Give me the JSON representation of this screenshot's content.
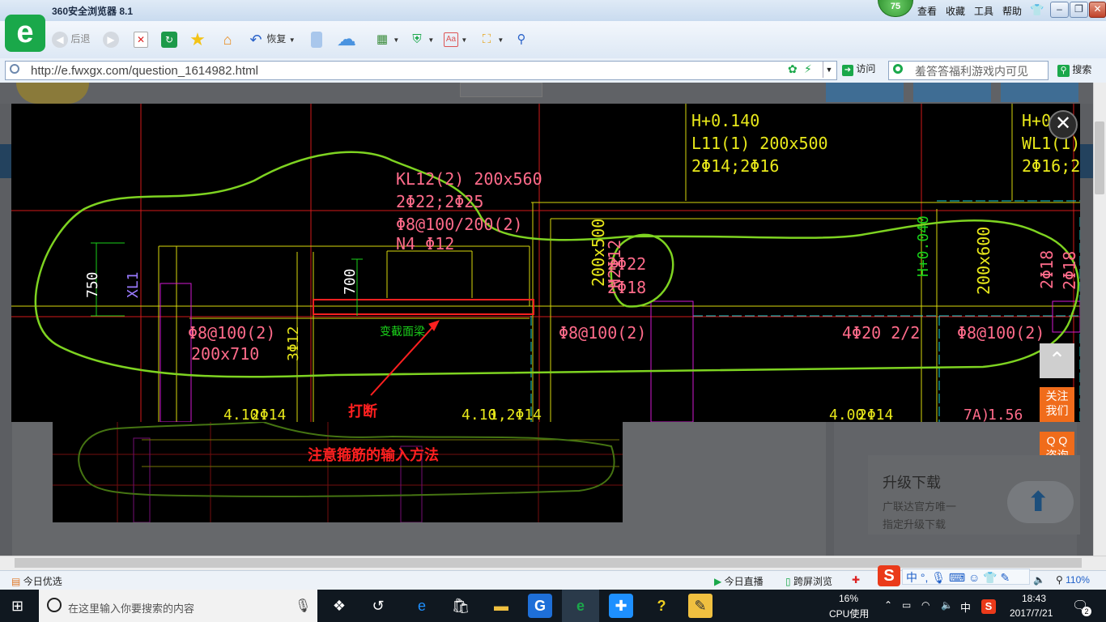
{
  "window": {
    "title": "360安全浏览器 8.1",
    "badge": "75",
    "menu": [
      "查看",
      "收藏",
      "工具",
      "帮助"
    ],
    "controls": {
      "minimize": "–",
      "maximize": "❐",
      "close": "✕"
    }
  },
  "toolbar": {
    "back_label": "后退",
    "restore_label": "恢复"
  },
  "address": {
    "url": "http://e.fwxgx.com/question_1614982.html",
    "go_label": "访问",
    "search_text": "羞答答福利游戏内可见",
    "search_label": "搜索"
  },
  "cad": {
    "annot_break": "打断",
    "annot_stirrup": "注意箍筋的输入方法",
    "labels": {
      "h1": "H+0.140",
      "l11": "L11(1) 200x500",
      "l11b": "2Φ14;2Φ16",
      "h2": "H+0",
      "wl1": "WL1(1) 2(",
      "wl1b": "2Φ16;2Φ",
      "kl12": "KL12(2) 200x560",
      "kl12b": "2Φ22;2Φ25",
      "kl12c": "Φ8@100/200(2)",
      "kl12d": "N4 Φ12",
      "dim750": "750",
      "xl1": "XL1",
      "dim700": "700",
      "sec": "变截面梁",
      "st1": "Φ8@100(2)",
      "size1": "200x710",
      "bar3": "3Φ12",
      "st2": "Φ8@100(2)",
      "bar4": "4Φ20 2/2",
      "st3": "Φ8@100(2)",
      "sz500": "200x500",
      "n2": "N2Φ12",
      "b22": "2Φ22",
      "b18": "2Φ18",
      "h3": "H+0.040",
      "sz600": "200x600",
      "r1": "2Φ18",
      "r2": "2Φ18",
      "btm1": "4.10",
      "btm2": "2Φ14",
      "btm3": "4.10",
      "btm4": "1,2Φ14",
      "btm5": "4.00",
      "btm6": "2Φ14",
      "btm7": "7A)",
      "btm8": "1.56"
    }
  },
  "side_buttons": {
    "follow": [
      "关注",
      "我们"
    ],
    "qq": [
      "Q Q",
      "咨询"
    ]
  },
  "download_card": {
    "title": "升级下载",
    "line1": "广联达官方唯一",
    "line2": "指定升级下载"
  },
  "statusbar": {
    "left": "今日优选",
    "live": "今日直播",
    "cross": "跨屏浏览",
    "zoom": "110%"
  },
  "taskbar": {
    "search_placeholder": "在这里输入你要搜索的内容",
    "cpu": "16%",
    "cpu_label": "CPU使用",
    "ime": "中",
    "time": "18:43",
    "date": "2017/7/21",
    "notifications": "2"
  }
}
